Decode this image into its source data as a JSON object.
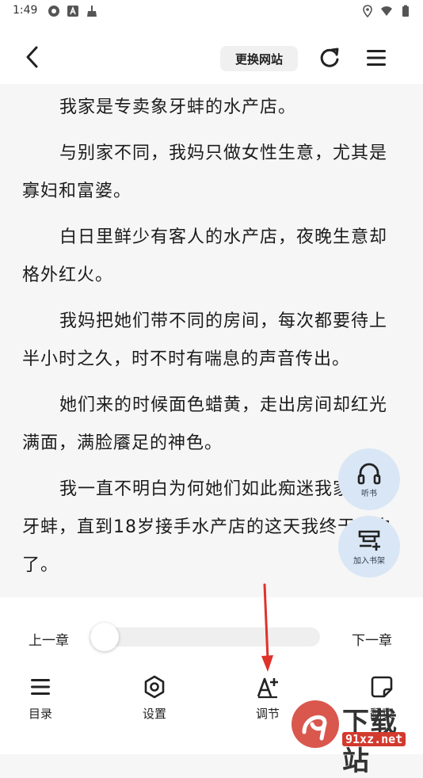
{
  "status_bar": {
    "time": "1:49"
  },
  "header": {
    "switch_site_label": "更换网站"
  },
  "reader": {
    "paragraphs": [
      "我家是专卖象牙蚌的水产店。",
      "与别家不同，我妈只做女性生意，尤其是寡妇和富婆。",
      "白日里鲜少有客人的水产店，夜晚生意却格外红火。",
      "我妈把她们带不同的房间，每次都要待上半小时之久，时不时有喘息的声音传出。",
      "她们来的时候面色蜡黄，走出房间却红光满面，满脸餍足的神色。",
      "我一直不明白为何她们如此痴迷我家的象牙蚌，直到18岁接手水产店的这天我终于明白了。"
    ]
  },
  "floating_buttons": {
    "listen_label": "听书",
    "add_shelf_label": "加入书架"
  },
  "bottom_panel": {
    "prev_chapter": "上一章",
    "next_chapter": "下一章",
    "progress": 0.06,
    "toolbar": {
      "catalog": "目录",
      "settings": "设置",
      "adjust": "调节",
      "page_turn": "翻页"
    }
  },
  "watermark": {
    "brand": "下载站",
    "url": "91xz.net"
  },
  "colors": {
    "fab_background": "#d9e6f5",
    "arrow": "#e0312b",
    "watermark_red": "#d23a2e"
  }
}
